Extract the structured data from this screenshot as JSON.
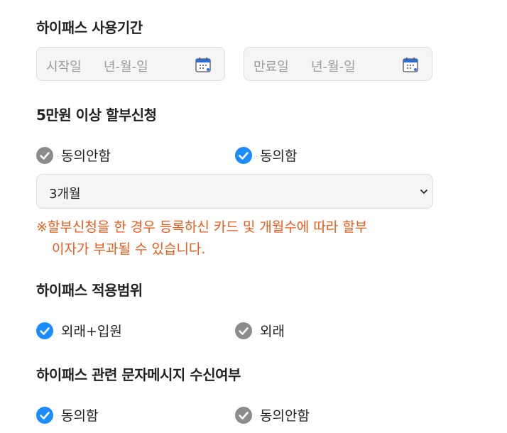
{
  "usage_period": {
    "title": "하이패스 사용기간",
    "start": {
      "label": "시작일",
      "placeholder": "년-월-일"
    },
    "end": {
      "label": "만료일",
      "placeholder": "년-월-일"
    }
  },
  "installment": {
    "title": "5만원 이상 할부신청",
    "options": [
      {
        "label": "동의안함",
        "checked": false
      },
      {
        "label": "동의함",
        "checked": true
      }
    ],
    "select_value": "3개월",
    "notice_line1": "※할부신청을 한 경우 등록하신 카드 및 개월수에 따라 할부",
    "notice_line2": "이자가 부과될 수 있습니다."
  },
  "scope": {
    "title": "하이패스 적용범위",
    "options": [
      {
        "label": "외래+입원",
        "checked": true
      },
      {
        "label": "외래",
        "checked": false
      }
    ]
  },
  "sms": {
    "title": "하이패스 관련 문자메시지 수신여부",
    "options": [
      {
        "label": "동의함",
        "checked": true
      },
      {
        "label": "동의안함",
        "checked": false
      }
    ]
  },
  "colors": {
    "checked": "#1a8cff",
    "unchecked": "#8c8c8c",
    "notice": "#ee5a1a",
    "calendar_icon": "#2a6fd6"
  }
}
